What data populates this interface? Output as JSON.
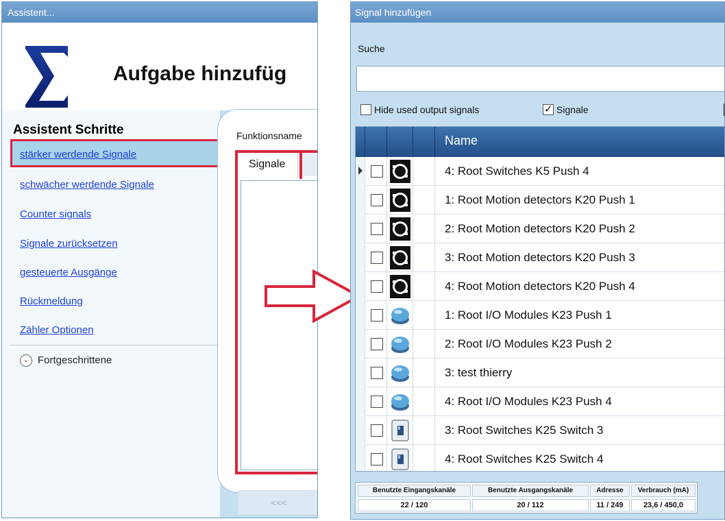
{
  "left_window": {
    "title": "Assistent...",
    "heading": "Aufgabe hinzufüg",
    "steps_title": "Assistent Schritte",
    "steps": [
      {
        "label": "stärker werdende Signale"
      },
      {
        "label": "schwächer werdende Signale"
      },
      {
        "label": "Counter signals"
      },
      {
        "label": "Signale zurücksetzen"
      },
      {
        "label": "gesteuerte Ausgänge"
      },
      {
        "label": "Rückmeldung"
      },
      {
        "label": "Zähler Optionen"
      }
    ],
    "active_step_index": 0,
    "advanced_label": "Fortgeschrittene",
    "function_name_label": "Funktionsname",
    "tab_label": "Signale",
    "back_button": "<<<"
  },
  "right_window": {
    "title": "Signal hinzufügen",
    "search_label": "Suche",
    "search_value": "",
    "hide_used_label": "Hide used output signals",
    "hide_used_checked": false,
    "signale_label": "Signale",
    "signale_checked": true,
    "column_name": "Name",
    "rows": [
      {
        "name": "4: Root Switches K5 Push 4",
        "icon": "push-button-black-icon",
        "current": true
      },
      {
        "name": "1: Root Motion detectors K20 Push 1",
        "icon": "push-button-black-icon"
      },
      {
        "name": "2: Root Motion detectors K20 Push 2",
        "icon": "push-button-black-icon"
      },
      {
        "name": "3: Root Motion detectors K20 Push 3",
        "icon": "push-button-black-icon"
      },
      {
        "name": "4: Root Motion detectors K20 Push 4",
        "icon": "push-button-black-icon"
      },
      {
        "name": "1: Root I/O Modules K23 Push 1",
        "icon": "push-button-blue-icon"
      },
      {
        "name": "2: Root I/O Modules K23 Push 2",
        "icon": "push-button-blue-icon"
      },
      {
        "name": "3: test thierry",
        "icon": "push-button-blue-icon"
      },
      {
        "name": "4: Root I/O Modules K23 Push 4",
        "icon": "push-button-blue-icon"
      },
      {
        "name": "3: Root Switches K25 Switch 3",
        "icon": "switch-icon"
      },
      {
        "name": "4: Root Switches K25 Switch 4",
        "icon": "switch-icon"
      }
    ],
    "status": {
      "headers": [
        "Benutzte Eingangskanäle",
        "Benutzte Ausgangskanäle",
        "Adresse",
        "Verbrauch (mA)"
      ],
      "values": [
        "22 / 120",
        "20 / 112",
        "11 / 249",
        "23,6 / 450,0"
      ]
    }
  },
  "colors": {
    "titlebar": "#5b8fc3",
    "highlight_red": "#d7263b",
    "active_step_bg": "#a9d3ea",
    "grid_header": "#234f87",
    "link": "#1c3fd8"
  }
}
